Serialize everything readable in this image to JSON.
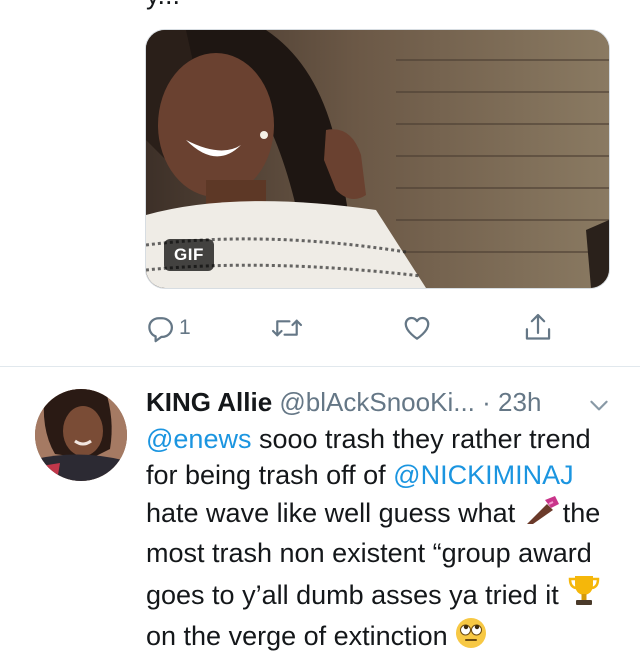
{
  "previous_tweet": {
    "clipped_text": "y..."
  },
  "media": {
    "badge": "GIF"
  },
  "actions": {
    "reply_count": "1"
  },
  "tweet": {
    "display_name": "KING Allie",
    "handle": "@blAckSnooKi...",
    "separator": "·",
    "time": "23h",
    "body": {
      "mention_1": "@enews",
      "text_1": " sooo trash they rather trend for being trash off of ",
      "mention_2": "@NICKIMINAJ",
      "text_2": "  hate wave like well guess what ",
      "text_3": "the most trash non existent “group award goes to y’all dumb asses ya tried it ",
      "text_4": " on the verge of extinction "
    },
    "emojis": [
      "nail-polish-icon",
      "trophy-icon",
      "rolling-eyes-icon"
    ]
  },
  "colors": {
    "link": "#1b95e0",
    "secondary_text": "#657786",
    "divider": "#e1e8ed"
  }
}
